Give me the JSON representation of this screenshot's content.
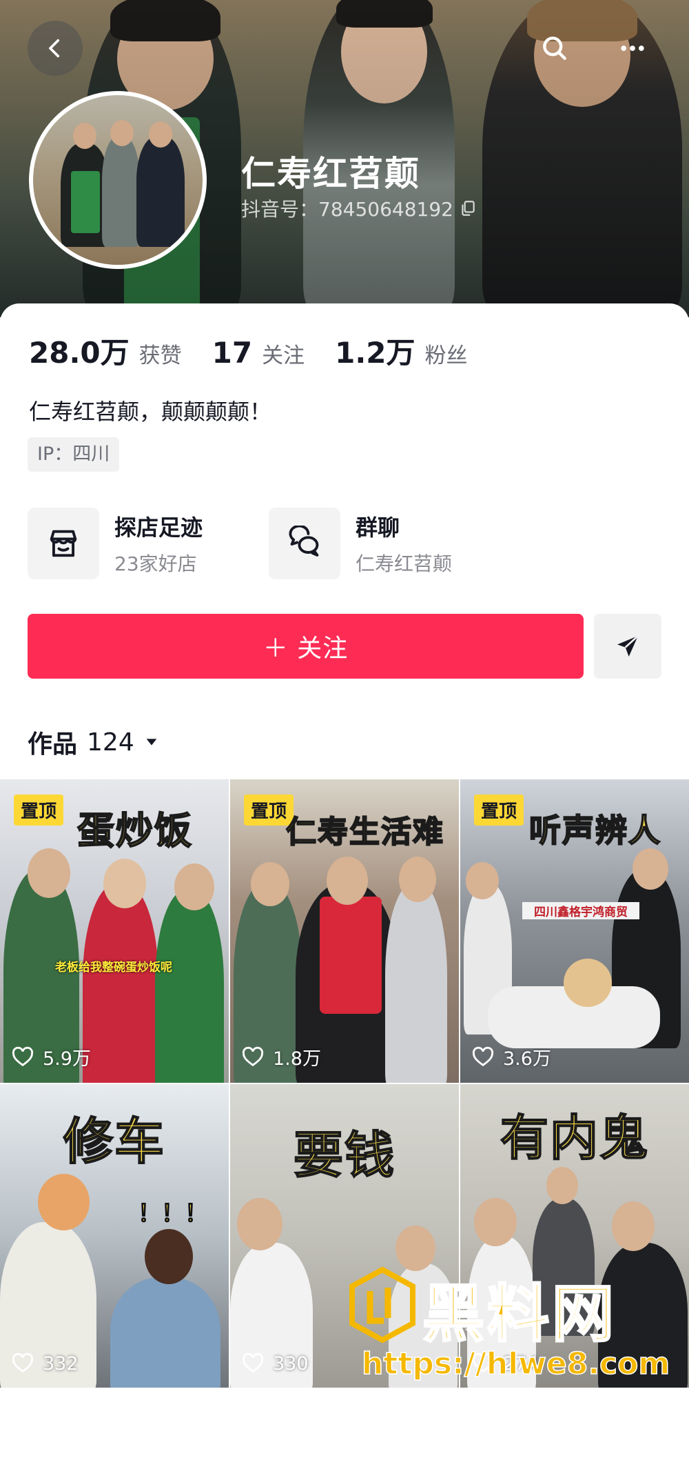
{
  "header": {
    "nickname": "仁寿红苕颠",
    "douyin_id": "抖音号：78450648192"
  },
  "stats": [
    {
      "value": "28.0万",
      "label": "获赞"
    },
    {
      "value": "17",
      "label": "关注"
    },
    {
      "value": "1.2万",
      "label": "粉丝"
    }
  ],
  "bio": "仁寿红苕颠，颠颠颠颠！",
  "ip": "IP：四川",
  "features": [
    {
      "title": "探店足迹",
      "subtitle": "23家好店",
      "icon": "store-icon"
    },
    {
      "title": "群聊",
      "subtitle": "仁寿红苕颠",
      "icon": "group-chat-icon"
    }
  ],
  "follow_button": "＋ 关注",
  "works": {
    "label": "作品",
    "count": "124"
  },
  "videos": [
    {
      "pinned": "置顶",
      "title": "蛋炒饭",
      "likes": "5.9万",
      "caption": "老板给我整碗蛋炒饭呢"
    },
    {
      "pinned": "置顶",
      "title": "仁寿生活难",
      "likes": "1.8万"
    },
    {
      "pinned": "置顶",
      "title": "听声辨人",
      "likes": "3.6万",
      "sign": "四川鑫格宇鸿商贸"
    },
    {
      "title": "修车",
      "likes": "332",
      "exclaim": "！！！"
    },
    {
      "title": "要钱",
      "likes": "330"
    },
    {
      "title": "有内鬼",
      "likes": "274"
    }
  ],
  "watermark": {
    "text": "黑料网",
    "url": "https://hlwe8.com"
  },
  "colors": {
    "accent": "#fe2c55",
    "pin": "#fdd835",
    "title_yellow": "#ffe24a"
  }
}
